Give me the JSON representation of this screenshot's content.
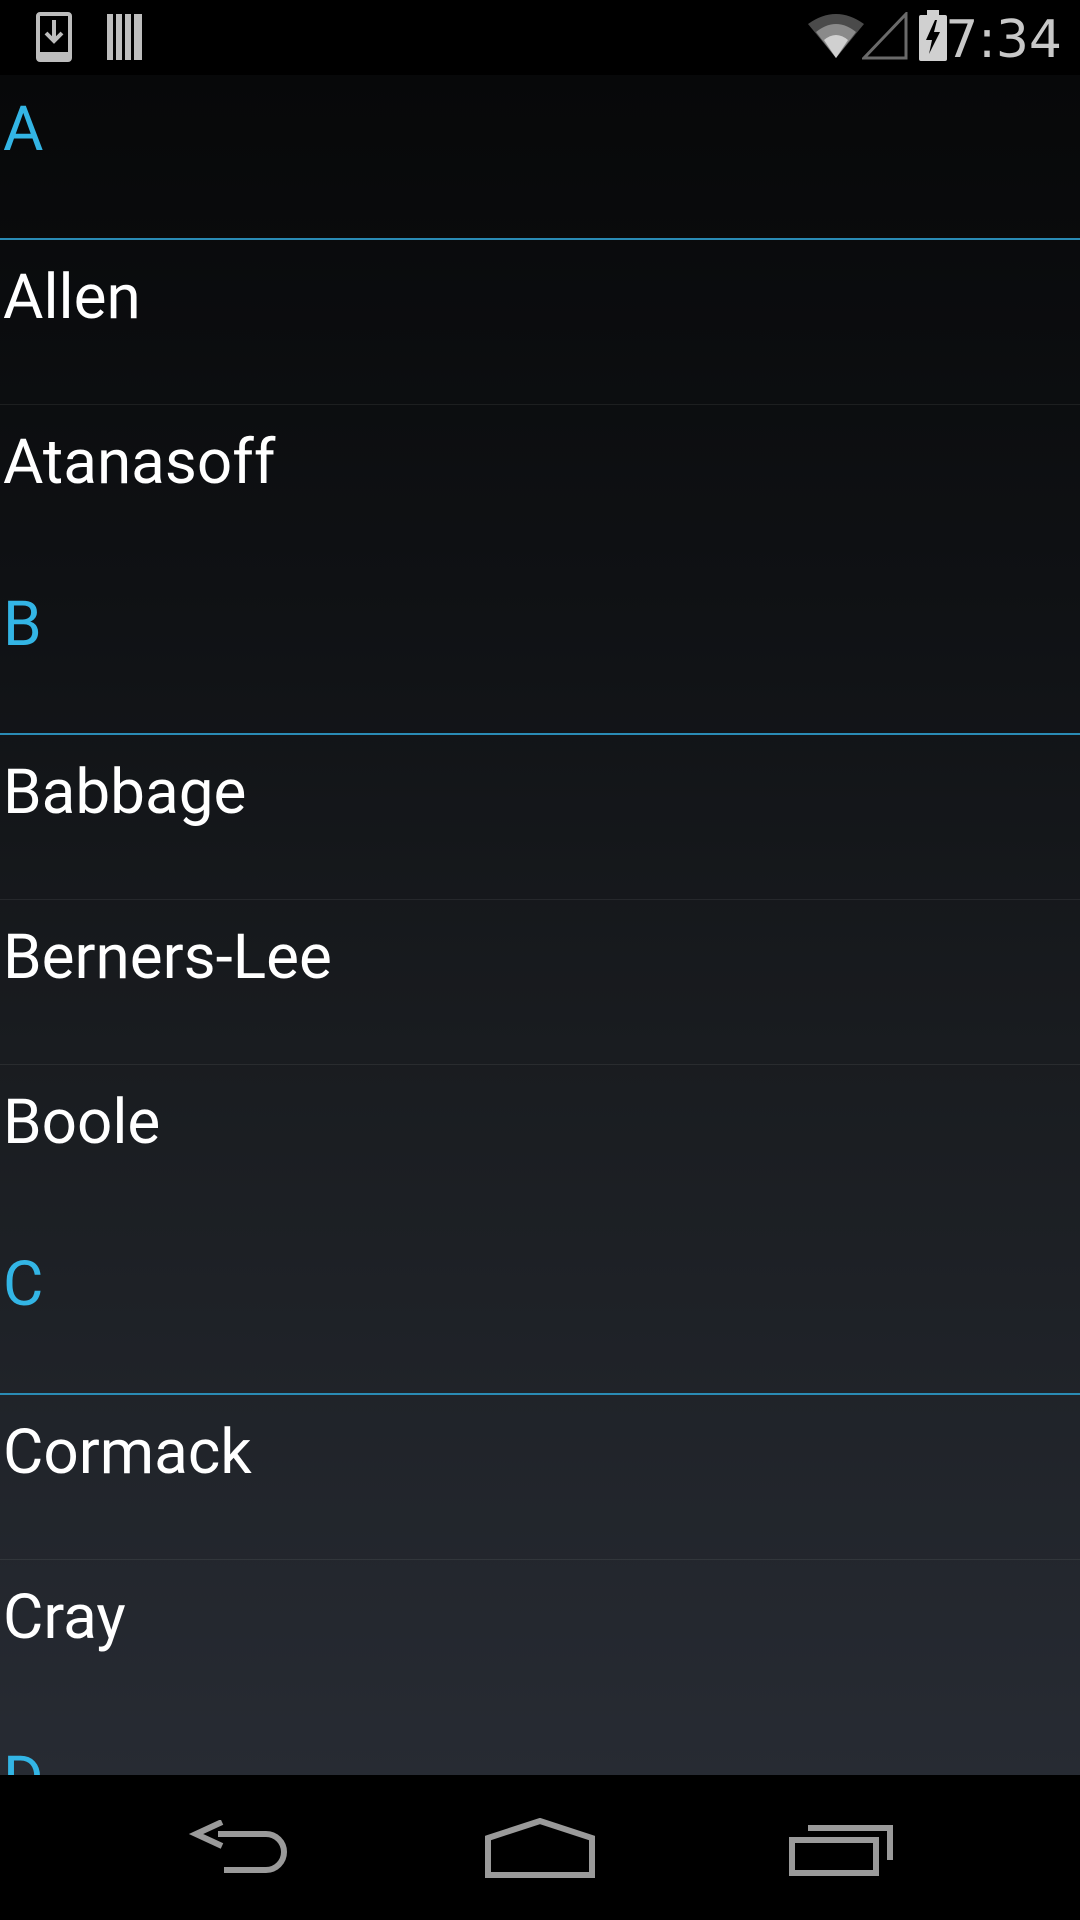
{
  "status_bar": {
    "time": "7:34",
    "icons": [
      "download-notification-icon",
      "barcode-notification-icon",
      "wifi-icon",
      "cell-signal-icon",
      "battery-charging-icon"
    ]
  },
  "list": {
    "sections": [
      {
        "letter": "A",
        "items": [
          "Allen",
          "Atanasoff"
        ]
      },
      {
        "letter": "B",
        "items": [
          "Babbage",
          "Berners-Lee",
          "Boole"
        ]
      },
      {
        "letter": "C",
        "items": [
          "Cormack",
          "Cray"
        ]
      },
      {
        "letter": "D",
        "items": []
      }
    ]
  },
  "nav_bar": {
    "icons": [
      "back-icon",
      "home-icon",
      "recents-icon"
    ]
  },
  "colors": {
    "accent": "#33b5e5",
    "divider": "#2a8bb5",
    "text": "#ffffff",
    "status_text": "#c8c8c8"
  }
}
